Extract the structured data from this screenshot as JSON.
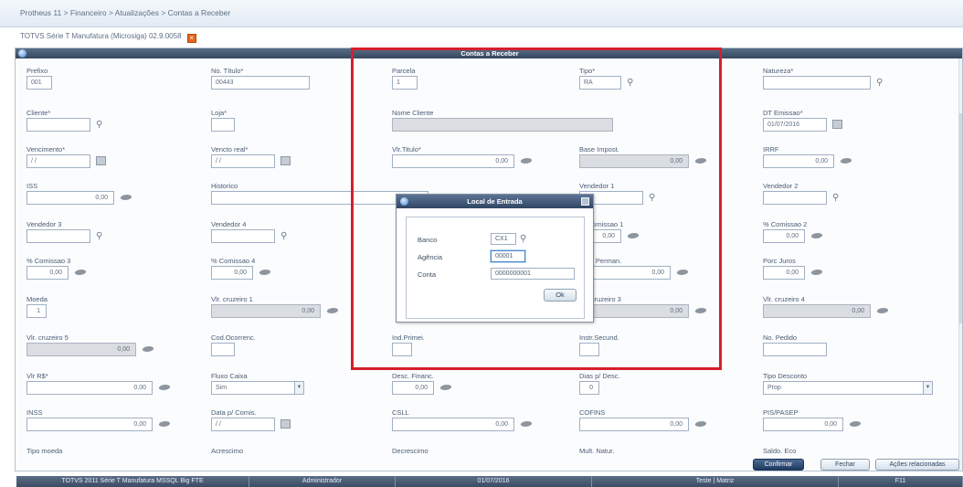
{
  "breadcrumb": "Protheus 11 > Financeiro > Atualizações > Contas a Receber",
  "window_title": "TOTVS Série T Manufatura (Microsiga) 02.9.0058",
  "panel_title": "Contas a Receber",
  "fields": {
    "prefixo": {
      "label": "Prefixo",
      "value": "001"
    },
    "no_titulo": {
      "label": "No. Título*",
      "value": "00443"
    },
    "parcela": {
      "label": "Parcela",
      "value": "1"
    },
    "tipo": {
      "label": "Tipo*",
      "value": "RA"
    },
    "natureza": {
      "label": "Natureza*",
      "value": ""
    },
    "cliente": {
      "label": "Cliente*",
      "value": ""
    },
    "loja": {
      "label": "Loja*",
      "value": ""
    },
    "nome_cliente": {
      "label": "Nome Cliente",
      "value": ""
    },
    "dt_emissao": {
      "label": "DT Emissao*",
      "value": "01/07/2016"
    },
    "vencimento": {
      "label": "Vencimento*",
      "value": "/ /"
    },
    "vencto_real": {
      "label": "Vencto real*",
      "value": "/ /"
    },
    "vlr_titulo": {
      "label": "Vlr.Titulo*",
      "value": "0,00"
    },
    "base_impost": {
      "label": "Base Impost.",
      "value": "0,00"
    },
    "irrf": {
      "label": "IRRF",
      "value": "0,00"
    },
    "iss": {
      "label": "ISS",
      "value": "0,00"
    },
    "historico": {
      "label": "Historico",
      "value": ""
    },
    "vendedor_1": {
      "label": "Vendedor 1",
      "value": ""
    },
    "vendedor_2": {
      "label": "Vendedor 2",
      "value": ""
    },
    "vendedor_3": {
      "label": "Vendedor 3",
      "value": ""
    },
    "vendedor_4": {
      "label": "Vendedor 4",
      "value": ""
    },
    "comissao_1": {
      "label": "% Comissao 1",
      "value": "0,00"
    },
    "comissao_2": {
      "label": "% Comissao 2",
      "value": "0,00"
    },
    "comissao_3": {
      "label": "% Comissao 3",
      "value": "0,00"
    },
    "comissao_4": {
      "label": "% Comissao 4",
      "value": "0,00"
    },
    "taxa_permanencia": {
      "label": "Taxa Perman.",
      "value": "0,00"
    },
    "porc_juros": {
      "label": "Porc Juros",
      "value": "0,00"
    },
    "moeda": {
      "label": "Moeda",
      "value": "1"
    },
    "vlr_cruzeiro_1": {
      "label": "Vlr. cruzeiro 1",
      "value": "0,00"
    },
    "vlr_cruzeiro_3": {
      "label": "Vlr. cruzeiro 3",
      "value": "0,00"
    },
    "vlr_cruzeiro_4": {
      "label": "Vlr. cruzeiro 4",
      "value": "0,00"
    },
    "vlr_cruzeiro_5": {
      "label": "Vlr. cruzeiro 5",
      "value": "0,00"
    },
    "cod_ocorrencia": {
      "label": "Cod.Ocorrenc.",
      "value": ""
    },
    "ind_primeir": {
      "label": "Ind.Primei.",
      "value": ""
    },
    "instr_secund": {
      "label": "Instr.Secund.",
      "value": ""
    },
    "no_pedido": {
      "label": "No. Pedido",
      "value": ""
    },
    "vlr_r": {
      "label": "Vlr R$*",
      "value": "0,00"
    },
    "fluxo_caixa": {
      "label": "Fluxo Caixa",
      "value": "Sim"
    },
    "desc_financ": {
      "label": "Desc. Financ.",
      "value": "0,00"
    },
    "dias_p_desc": {
      "label": "Dias p/ Desc.",
      "value": "0"
    },
    "tipo_desconto": {
      "label": "Tipo Desconto",
      "value": "Prop"
    },
    "inss": {
      "label": "INSS",
      "value": "0,00"
    },
    "data_p_comis": {
      "label": "Data p/ Comis.",
      "value": "/ /"
    },
    "csll": {
      "label": "CSLL",
      "value": "0,00"
    },
    "cofins": {
      "label": "COFINS",
      "value": "0,00"
    },
    "pis_pasep": {
      "label": "PIS/PASEP",
      "value": "0,00"
    }
  },
  "cut_labels": {
    "a": "Tipo moeda",
    "b": "Acrescimo",
    "c": "Decrescimo",
    "d": "Mult. Natur.",
    "e": "Saldo. Eco"
  },
  "dialog": {
    "title": "Local de Entrada",
    "banco_label": "Banco",
    "banco_value": "CX1",
    "agencia_label": "Agência",
    "agencia_value": "00001",
    "conta_label": "Conta",
    "conta_value": "0000000001",
    "ok_label": "Ok"
  },
  "buttons": {
    "confirm": "Confirmar",
    "cancel": "Fechar",
    "actions": "Ações relacionadas"
  },
  "statusbar": {
    "version": "TOTVS 2011 Série T Manufatura MSSQL Big FTE",
    "user": "Administrador",
    "date": "01/07/2016",
    "company": "Teste | Matriz",
    "key": "F11"
  }
}
